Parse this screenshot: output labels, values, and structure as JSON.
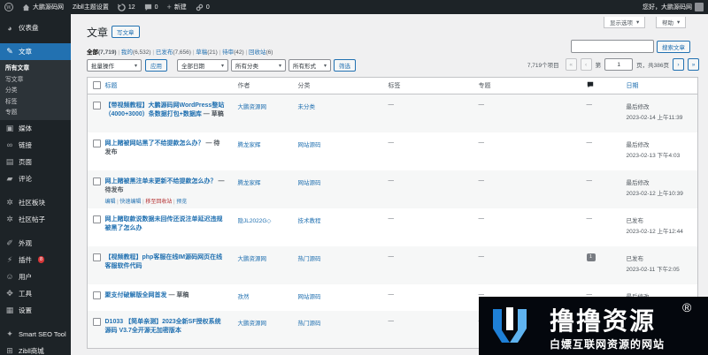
{
  "adminbar": {
    "site_name": "大鹏源码网",
    "theme_settings": "Zibll主题设置",
    "updates_count": "12",
    "comments_count": "0",
    "new_label": "新建",
    "plugin_count": "0",
    "greeting": "您好，大鹏源码网"
  },
  "sidebar": {
    "dashboard": "仪表盘",
    "posts": "文章",
    "posts_sub": [
      "所有文章",
      "写文章",
      "分类",
      "标签",
      "专题"
    ],
    "media": "媒体",
    "links": "链接",
    "pages": "页面",
    "comments": "评论",
    "community": "社区板块",
    "community_posts": "社区帖子",
    "appearance": "外观",
    "plugins": "插件",
    "plugins_badge": "8",
    "users": "用户",
    "tools": "工具",
    "settings": "设置",
    "seo": "Smart SEO Tool",
    "zibll_mall": "Zibll商城"
  },
  "screen_options": "显示选项",
  "help": "帮助",
  "page": {
    "title": "文章",
    "add_new": "写文章",
    "search_button": "搜索文章",
    "search_value": ""
  },
  "filters": [
    {
      "label": "全部",
      "count": "(7,719)"
    },
    {
      "label": "我的",
      "count": "(6,532)"
    },
    {
      "label": "已发布",
      "count": "(7,656)"
    },
    {
      "label": "草稿",
      "count": "(21)"
    },
    {
      "label": "待审",
      "count": "(42)"
    },
    {
      "label": "回收站",
      "count": "(6)"
    }
  ],
  "toolbar": {
    "bulk_actions": "批量操作",
    "apply": "应用",
    "all_dates": "全部日期",
    "all_categories": "所有分类",
    "all_formats": "所有形式",
    "filter": "筛选"
  },
  "pagination": {
    "items": "7,719个项目",
    "first": "«",
    "prev": "‹",
    "page_prefix": "第",
    "current_page": "1",
    "page_suffix": "页，共386页",
    "next": "›",
    "last": "»"
  },
  "columns": {
    "title": "标题",
    "author": "作者",
    "categories": "分类",
    "tags": "标签",
    "topics": "专题",
    "date": "日期"
  },
  "rows": [
    {
      "title": "【带视频教程】大鹏源码网WordPress整站（4000+3000）条数据打包+数据库",
      "state": "— 草稿",
      "author": "大鹏资源网",
      "category": "未分类",
      "tags": "—",
      "topics": "—",
      "comments": "—",
      "date_status": "最后修改",
      "date": "2023-02-14 上午11:39"
    },
    {
      "title": "网上赌被网站黑了不给提款怎么办？",
      "state": "— 待发布",
      "author": "腾龙家辉",
      "category": "网站源码",
      "tags": "—",
      "topics": "—",
      "comments": "—",
      "date_status": "最后修改",
      "date": "2023-02-13 下午4:03"
    },
    {
      "title": "网上赌被黑注单未更新不给提款怎么办？",
      "state": "— 待发布",
      "author": "腾龙家辉",
      "category": "网站源码",
      "tags": "—",
      "topics": "—",
      "comments": "—",
      "date_status": "最后修改",
      "date": "2023-02-12 上午10:39",
      "actions": [
        "编辑",
        "快速编辑",
        "移至回收站",
        "预览"
      ]
    },
    {
      "title": "网上赌取款说数据未回传还说注单延迟违规被黑了怎么办",
      "state": "",
      "author": "隐JL2022G◇",
      "category": "技术教程",
      "tags": "—",
      "topics": "—",
      "comments": "—",
      "date_status": "已发布",
      "date": "2023-02-12 上午12:44"
    },
    {
      "title": "【视频教程】php客服在线IM源码网页在线客服软件代码",
      "state": "",
      "author": "大鹏资源网",
      "category": "热门源码",
      "tags": "—",
      "topics": "—",
      "comments": "1",
      "date_status": "已发布",
      "date": "2023-02-11 下午2:05"
    },
    {
      "title": "聚支付破解版全网首发",
      "state": "— 草稿",
      "author": "孜然",
      "category": "网站源码",
      "tags": "—",
      "topics": "—",
      "comments": "—",
      "date_status": "最后修改",
      "date": ""
    },
    {
      "title": "D1033 【简单亲测】2023全新SF授权系统源码 V3.7全开源无加密版本",
      "state": "",
      "author": "大鹏资源网",
      "category": "热门源码",
      "tags": "—",
      "topics": "—",
      "comments": "",
      "date_status": "",
      "date": ""
    }
  ],
  "watermark": {
    "big": "撸撸资源",
    "reg": "®",
    "small": "白嫖互联网资源的网站"
  },
  "colors": {
    "accent": "#2271b1",
    "sidebar": "#1d2327",
    "danger": "#d63638"
  }
}
